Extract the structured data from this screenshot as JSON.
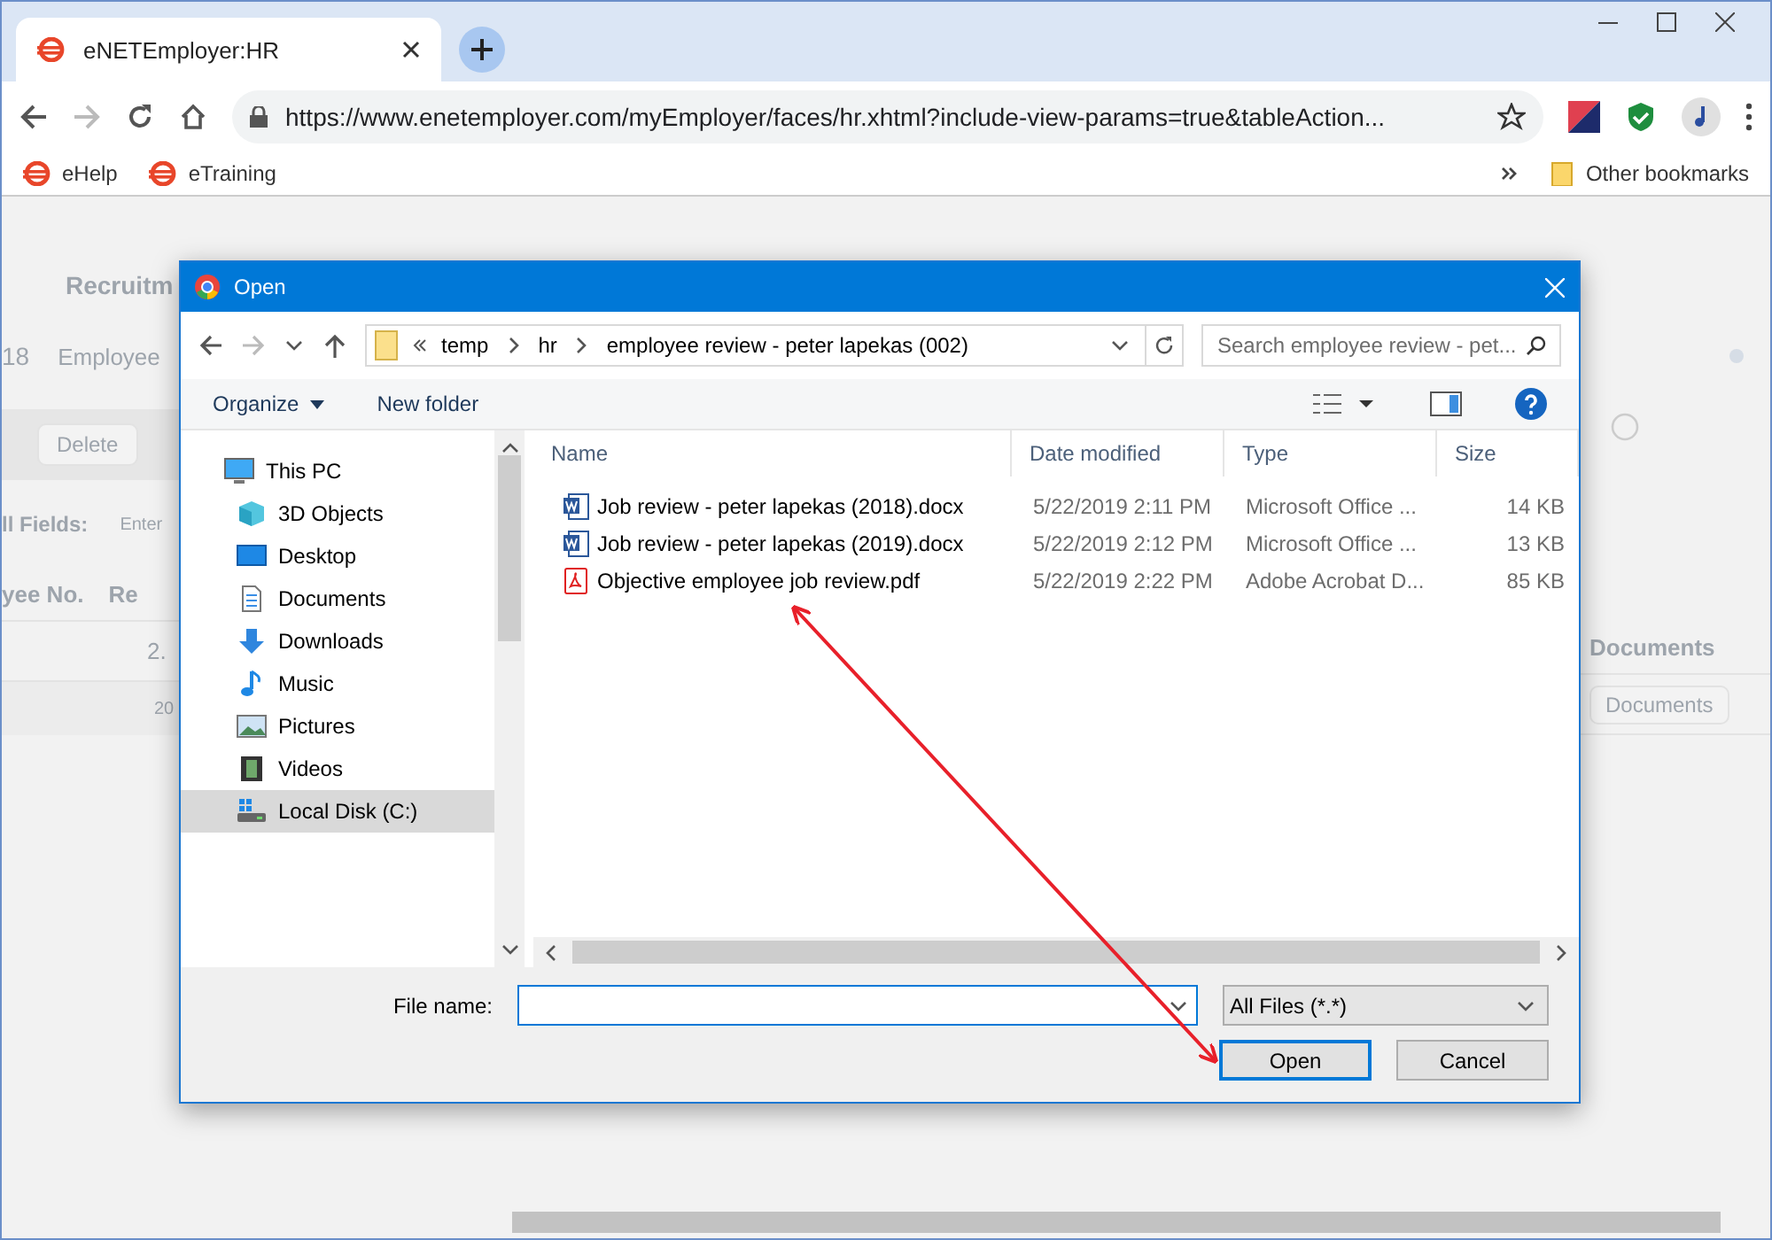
{
  "browser": {
    "tab_title": "eNETEmployer:HR",
    "url": "https://www.enetemployer.com/myEmployer/faces/hr.xhtml?include-view-params=true&tableAction...",
    "bookmarks": [
      "eHelp",
      "eTraining"
    ],
    "other_bookmarks": "Other bookmarks"
  },
  "background": {
    "left": {
      "tab": "Recruitm",
      "year": "18",
      "employee_field": "Employee",
      "delete_button": "Delete",
      "fields_label": "ll Fields:",
      "enter_field": "Enter",
      "column_1": "yee No.",
      "column_2": "Re",
      "cell": "2.",
      "pager": "20"
    },
    "right": {
      "column_header": "Documents",
      "documents_button": "Documents"
    }
  },
  "dialog": {
    "title": "Open",
    "breadcrumb": [
      "temp",
      "hr",
      "employee review - peter lapekas (002)"
    ],
    "search": {
      "placeholder": "Search employee review - pet..."
    },
    "toolbar": [
      "Organize",
      "New folder"
    ],
    "nav": [
      {
        "label": "This PC",
        "kind": "pc",
        "selected": false
      },
      {
        "label": "3D Objects",
        "kind": "cube",
        "selected": false
      },
      {
        "label": "Desktop",
        "kind": "desktop",
        "selected": false
      },
      {
        "label": "Documents",
        "kind": "documents",
        "selected": false
      },
      {
        "label": "Downloads",
        "kind": "downloads",
        "selected": false
      },
      {
        "label": "Music",
        "kind": "music",
        "selected": false
      },
      {
        "label": "Pictures",
        "kind": "pictures",
        "selected": false
      },
      {
        "label": "Videos",
        "kind": "videos",
        "selected": false
      },
      {
        "label": "Local Disk (C:)",
        "kind": "disk",
        "selected": true
      }
    ],
    "columns": [
      "Name",
      "Date modified",
      "Type",
      "Size"
    ],
    "files": [
      {
        "name": "Job review - peter lapekas (2018).docx",
        "date": "5/22/2019 2:11 PM",
        "type": "Microsoft Office ...",
        "size": "14 KB",
        "kind": "word"
      },
      {
        "name": "Job review - peter lapekas (2019).docx",
        "date": "5/22/2019 2:12 PM",
        "type": "Microsoft Office ...",
        "size": "13 KB",
        "kind": "word"
      },
      {
        "name": "Objective employee job review.pdf",
        "date": "5/22/2019 2:22 PM",
        "type": "Adobe Acrobat D...",
        "size": "85 KB",
        "kind": "pdf"
      }
    ],
    "file_name_label": "File name:",
    "filter": "All Files (*.*)",
    "buttons": [
      {
        "label": "Open",
        "default": true
      },
      {
        "label": "Cancel",
        "default": false
      }
    ]
  }
}
